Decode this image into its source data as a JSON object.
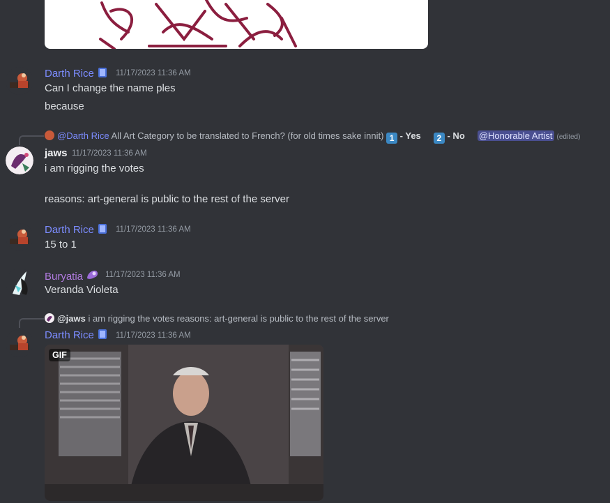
{
  "messages": [
    {
      "author": "Darth Rice",
      "timestamp": "11/17/2023 11:36 AM",
      "lines": [
        "Can I change the name ples",
        "because"
      ]
    },
    {
      "reply": {
        "author": "@Darth Rice",
        "text": "All Art Category to be translated to French? (for old times sake innit)",
        "yes_key": "1",
        "yes_label": "- Yes",
        "no_key": "2",
        "no_label": "- No",
        "mention": "@Honorable Artist",
        "edited": "(edited)"
      },
      "author": "jaws",
      "timestamp": "11/17/2023 11:36 AM",
      "lines": [
        "i am rigging the votes",
        "reasons: art-general is public to the rest of the server"
      ]
    },
    {
      "author": "Darth Rice",
      "timestamp": "11/17/2023 11:36 AM",
      "lines": [
        "15 to 1"
      ]
    },
    {
      "author": "Buryatia",
      "timestamp": "11/17/2023 11:36 AM",
      "lines": [
        "Veranda Violeta"
      ]
    },
    {
      "reply": {
        "author": "@jaws",
        "text": "i am rigging the votes reasons: art-general is public to the rest of the server"
      },
      "author": "Darth Rice",
      "timestamp": "11/17/2023 11:36 AM",
      "attachment": {
        "tag": "GIF"
      }
    }
  ],
  "colors": {
    "background": "#313338",
    "username_blue": "#7c8cff",
    "username_purple": "#b17be0",
    "mention_bg": "#4a4f91",
    "timestamp": "#949ba4"
  },
  "icons": [
    "darth-rice-avatar",
    "jaws-avatar",
    "buryatia-avatar",
    "blue-book-badge",
    "purple-badge",
    "keycap-1",
    "keycap-2"
  ]
}
